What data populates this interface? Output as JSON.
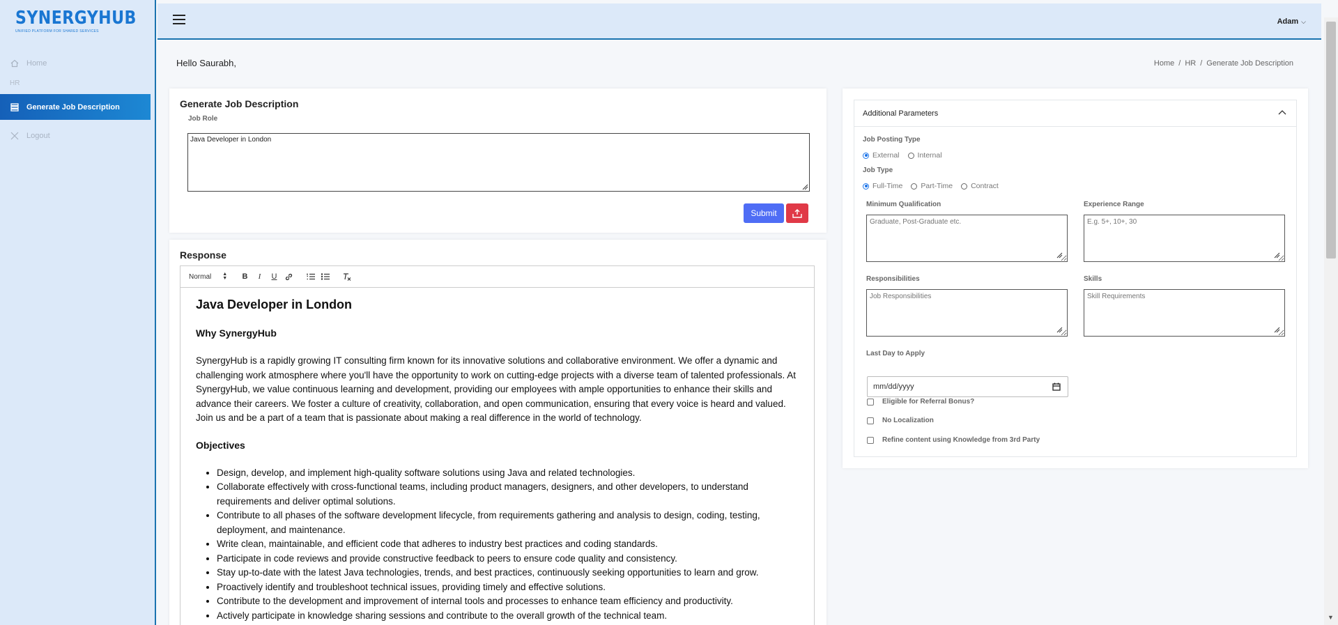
{
  "app": {
    "name": "SYNERGYHUB",
    "tagline": "UNIFIED PLATFORM FOR SHARED SERVICES"
  },
  "sidebar": {
    "home_label": "Home",
    "section_hr": "HR",
    "active_label": "Generate Job Description",
    "logout_label": "Logout"
  },
  "topbar": {
    "user_name": "Adam"
  },
  "greeting": "Hello Saurabh,",
  "breadcrumb": {
    "home": "Home",
    "hr": "HR",
    "current": "Generate Job Description",
    "separator": "/"
  },
  "generate": {
    "title": "Generate Job Description",
    "job_role_label": "Job Role",
    "job_role_value": "Java Developer in London",
    "submit_label": "Submit"
  },
  "response": {
    "title": "Response",
    "toolbar": {
      "format": "Normal",
      "bold": "B",
      "italic": "I",
      "underline": "U"
    },
    "heading": "Java Developer in London",
    "why_heading": "Why SynergyHub",
    "why_text": "SynergyHub is a rapidly growing IT consulting firm known for its innovative solutions and collaborative environment. We offer a dynamic and challenging work atmosphere where you'll have the opportunity to work on cutting-edge projects with a diverse team of talented professionals. At SynergyHub, we value continuous learning and development, providing our employees with ample opportunities to enhance their skills and advance their careers. We foster a culture of creativity, collaboration, and open communication, ensuring that every voice is heard and valued. Join us and be a part of a team that is passionate about making a real difference in the world of technology.",
    "objectives_heading": "Objectives",
    "objectives": [
      "Design, develop, and implement high-quality software solutions using Java and related technologies.",
      "Collaborate effectively with cross-functional teams, including product managers, designers, and other developers, to understand requirements and deliver optimal solutions.",
      "Contribute to all phases of the software development lifecycle, from requirements gathering and analysis to design, coding, testing, deployment, and maintenance.",
      "Write clean, maintainable, and efficient code that adheres to industry best practices and coding standards.",
      "Participate in code reviews and provide constructive feedback to peers to ensure code quality and consistency.",
      "Stay up-to-date with the latest Java technologies, trends, and best practices, continuously seeking opportunities to learn and grow.",
      "Proactively identify and troubleshoot technical issues, providing timely and effective solutions.",
      "Contribute to the development and improvement of internal tools and processes to enhance team efficiency and productivity.",
      "Actively participate in knowledge sharing sessions and contribute to the overall growth of the technical team."
    ]
  },
  "params": {
    "title": "Additional Parameters",
    "posting_type_label": "Job Posting Type",
    "posting_external": "External",
    "posting_internal": "Internal",
    "job_type_label": "Job Type",
    "job_full_time": "Full-Time",
    "job_part_time": "Part-Time",
    "job_contract": "Contract",
    "min_qual_label": "Minimum Qualification",
    "min_qual_placeholder": "Graduate, Post-Graduate etc.",
    "exp_label": "Experience Range",
    "exp_placeholder": "E.g. 5+, 10+, 30",
    "resp_label": "Responsibilities",
    "resp_placeholder": "Job Responsibilities",
    "skills_label": "Skills",
    "skills_placeholder": "Skill Requirements",
    "last_day_label": "Last Day to Apply",
    "date_placeholder": "mm/dd/yyyy",
    "referral_label": "Eligible for Referral Bonus?",
    "no_localization_label": "No Localization",
    "refine_label": "Refine content using Knowledge from 3rd Party"
  },
  "colors": {
    "brand": "#1976d2",
    "sidebar_bg": "#dce9f9",
    "active_nav": "#1560b8",
    "submit": "#4f6df5",
    "upload": "#e03947"
  }
}
